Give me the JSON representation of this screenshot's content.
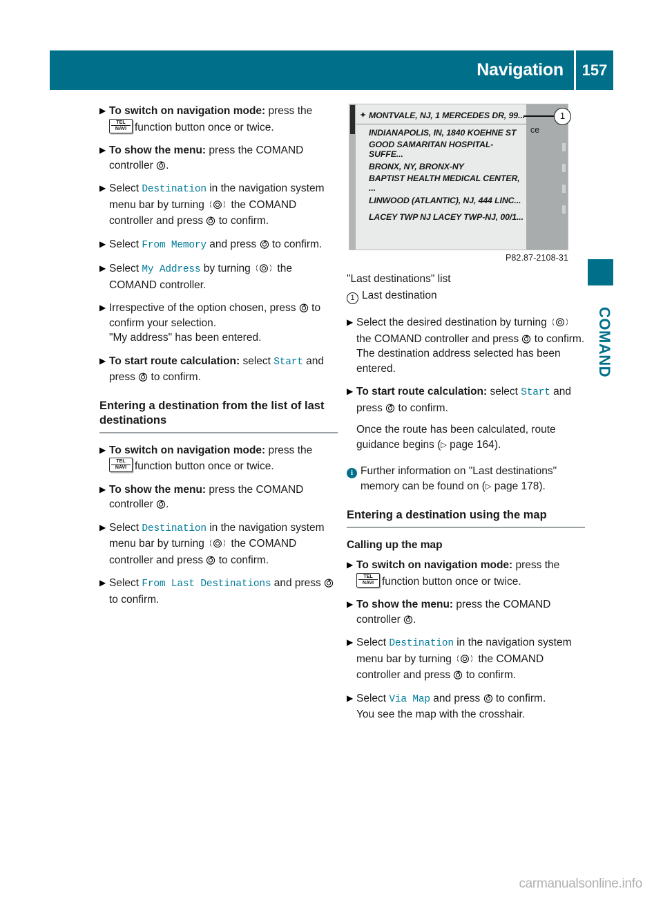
{
  "header": {
    "title": "Navigation",
    "page_number": "157"
  },
  "side_tab": {
    "label": "COMAND"
  },
  "icons": {
    "telnavi_top": "TEL",
    "telnavi_bottom": "NAVI",
    "press_controller": "press-controller-icon",
    "turn_controller": "turn-controller-icon",
    "info": "i",
    "page_ref_arrow": "▷",
    "bullet": "▶"
  },
  "left_column": {
    "steps_memory": [
      {
        "bold": "To switch on navigation mode:",
        "text_before_icon": " press the",
        "text_after_icon": "function button once or twice.",
        "has_telnavi": true
      },
      {
        "bold": "To show the menu:",
        "text": " press the COMAND controller",
        "tail": "."
      }
    ],
    "step_destination": {
      "lead": "Select ",
      "term": "Destination",
      "mid": " in the navigation system menu bar by turning ",
      "mid2": " the COMAND controller and press ",
      "tail": " to confirm."
    },
    "step_from_memory": {
      "lead": "Select ",
      "term": "From Memory",
      "mid": " and press ",
      "tail": " to confirm."
    },
    "step_my_address": {
      "lead": "Select ",
      "term": "My Address",
      "mid": " by turning ",
      "tail": " the COMAND controller."
    },
    "step_irrespective": {
      "lead": "Irrespective of the option chosen, press ",
      "tail": " to confirm your selection.",
      "note": "\"My address\" has been entered."
    },
    "step_start_route": {
      "bold": "To start route calculation:",
      "lead": " select ",
      "term": "Start",
      "tail": " and press ",
      "tail2": " to confirm."
    },
    "heading_last_destinations": "Entering a destination from the list of last destinations",
    "steps_last": [
      {
        "bold": "To switch on navigation mode:",
        "text_before_icon": " press the",
        "text_after_icon": "function button once or twice.",
        "has_telnavi": true
      },
      {
        "bold": "To show the menu:",
        "text": " press the COMAND controller",
        "tail": "."
      }
    ],
    "step_destination_2": {
      "lead": "Select ",
      "term": "Destination",
      "mid": " in the navigation system menu bar by turning ",
      "mid2": " the COMAND controller and press ",
      "tail": " to confirm."
    },
    "step_from_last": {
      "lead": "Select ",
      "term": "From Last Destinations",
      "mid": " and press ",
      "tail": " to confirm."
    }
  },
  "right_column": {
    "figure": {
      "caption": "P82.87-2108-31",
      "callout_number": "1",
      "right_panel_text": "ce",
      "list_items": [
        {
          "marker": "✦",
          "text": "MONTVALE, NJ, 1 MERCEDES DR, 99...",
          "selected": true
        },
        {
          "marker": "",
          "text": "INDIANAPOLIS, IN, 1840 KOEHNE ST",
          "selected": false
        },
        {
          "marker": "",
          "text": "GOOD SAMARITAN HOSPITAL-SUFFE...",
          "selected": false
        },
        {
          "marker": "",
          "text": "BRONX, NY, BRONX-NY",
          "selected": false
        },
        {
          "marker": "",
          "text": "BAPTIST HEALTH MEDICAL CENTER, ...",
          "selected": false
        },
        {
          "marker": "",
          "text": "LINWOOD (ATLANTIC), NJ, 444 LINC...",
          "selected": false
        },
        {
          "marker": "",
          "text": "LACEY TWP NJ LACEY TWP-NJ, 00/1...",
          "selected": false
        }
      ]
    },
    "legend_title": "\"Last destinations\" list",
    "legend_num": "1",
    "legend_text": "Last destination",
    "step_select_destination": {
      "lead": "Select the desired destination by turning ",
      "mid": " the COMAND controller and press ",
      "tail": " to confirm.",
      "note": "The destination address selected has been entered."
    },
    "step_start_route": {
      "bold": "To start route calculation:",
      "lead": " select ",
      "term": "Start",
      "tail": " and press ",
      "tail2": " to confirm.",
      "note_lead": "Once the route has been calculated, route guidance begins (",
      "note_page": " page 164",
      "note_tail": ")."
    },
    "info_block": {
      "lead": "Further information on \"Last destinations\" memory can be found on (",
      "page": " page 178",
      "tail": ")."
    },
    "heading_map": "Entering a destination using the map",
    "subheading_calling_map": "Calling up the map",
    "steps_map": [
      {
        "bold": "To switch on navigation mode:",
        "text_before_icon": " press the",
        "text_after_icon": "function button once or twice.",
        "has_telnavi": true
      },
      {
        "bold": "To show the menu:",
        "text": " press the COMAND controller",
        "tail": "."
      }
    ],
    "step_destination_3": {
      "lead": "Select ",
      "term": "Destination",
      "mid": " in the navigation system menu bar by turning ",
      "mid2": " the COMAND controller and press ",
      "tail": " to confirm."
    },
    "step_via_map": {
      "lead": "Select ",
      "term": "Via Map",
      "mid": " and press ",
      "tail": " to confirm.",
      "note": "You see the map with the crosshair."
    }
  },
  "footer": {
    "watermark": "carmanualsonline.info"
  }
}
